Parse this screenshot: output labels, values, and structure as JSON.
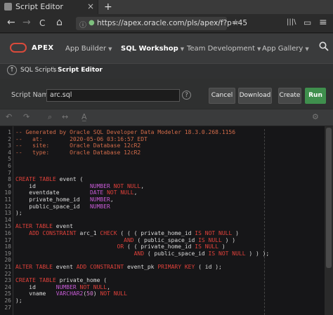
{
  "browser": {
    "tab_title": "Script Editor",
    "tab_close": "×",
    "new_tab": "+",
    "back": "←",
    "forward": "→",
    "reload": "C",
    "home": "⌂",
    "url": "https://apex.oracle.com/pls/apex/f?p=45",
    "url_menu": "···",
    "star": "☆",
    "library": "|||\\",
    "sidebar": "▭",
    "menu": "≡"
  },
  "apex": {
    "brand": "APEX",
    "menu": [
      {
        "label": "App Builder"
      },
      {
        "label": "SQL Workshop"
      },
      {
        "label": "Team Development"
      },
      {
        "label": "App Gallery"
      }
    ]
  },
  "breadcrumb": {
    "up": "↑",
    "parent": "SQL Scripts",
    "separator": "\\",
    "current": "Script Editor"
  },
  "script": {
    "name_label": "Script Name",
    "name_value": "arc.sql",
    "help": "?",
    "buttons": {
      "cancel": "Cancel",
      "download": "Download",
      "create": "Create",
      "run": "Run"
    }
  },
  "toolbar": {
    "undo": "↶",
    "redo": "↷",
    "search": "⌕",
    "replace": "↔",
    "text": "A̲",
    "settings": "⚙"
  },
  "editor": {
    "line_numbers": [
      "1",
      "2",
      "3",
      "4",
      "5",
      "6",
      "7",
      "8",
      "9",
      "10",
      "11",
      "12",
      "13",
      "14",
      "15",
      "16",
      "17",
      "18",
      "19",
      "20",
      "21",
      "22",
      "23",
      "24",
      "25",
      "26",
      "27"
    ]
  },
  "colors": {
    "accent_red": "#d94a3b",
    "run_green": "#3f8f4d",
    "keyword": "#e0413a",
    "comment": "#d36c4a",
    "type": "#c75bd6"
  }
}
